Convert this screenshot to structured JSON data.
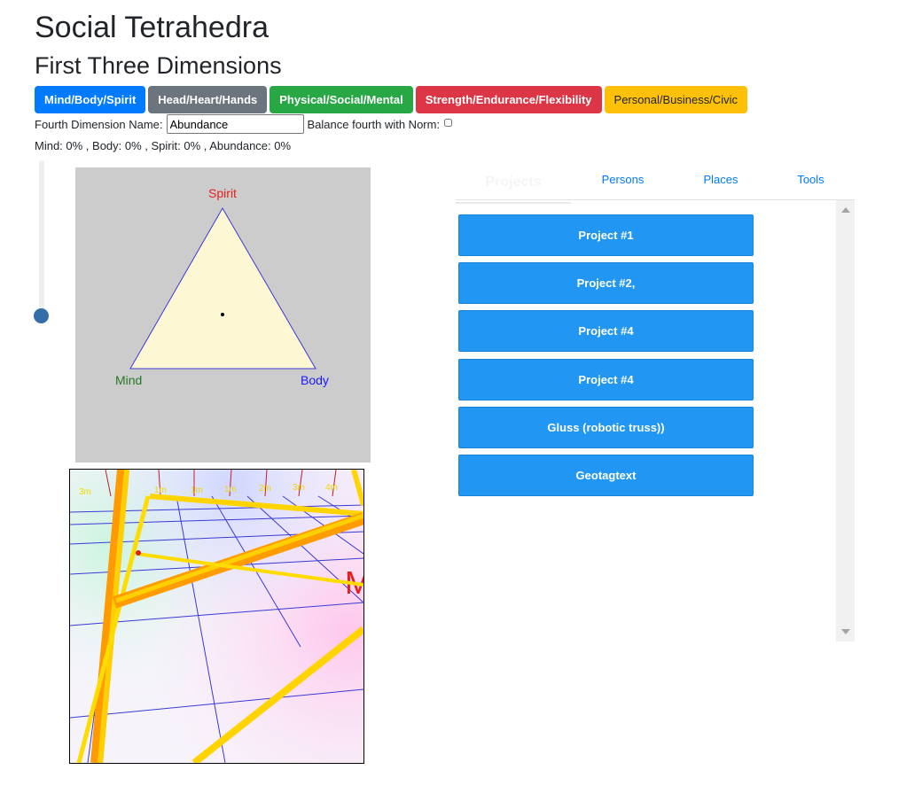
{
  "header": {
    "title": "Social Tetrahedra",
    "subtitle": "First Three Dimensions"
  },
  "presets": [
    {
      "label": "Mind/Body/Spirit",
      "color": "#007bff"
    },
    {
      "label": "Head/Heart/Hands",
      "color": "#6c757d"
    },
    {
      "label": "Physical/Social/Mental",
      "color": "#28a745"
    },
    {
      "label": "Strength/Endurance/Flexibility",
      "color": "#dc3545"
    },
    {
      "label": "Personal/Business/Civic",
      "color": "#ffc107"
    }
  ],
  "fourth": {
    "label": "Fourth Dimension Name:",
    "value": "Abundance",
    "balance_label": "Balance fourth with Norm:",
    "balance_checked": false
  },
  "percentages": "Mind: 0% , Body: 0% , Spirit: 0% , Abundance: 0%",
  "slider": {
    "value": 0
  },
  "triangle": {
    "top_label": "Spirit",
    "left_label": "Mind",
    "right_label": "Body",
    "colors": {
      "top": "#e8201e",
      "left": "#237a23",
      "right": "#1a1aff",
      "fill": "#fdf8d3",
      "stroke": "#3a3ad6"
    }
  },
  "scene": {
    "grid_labels": [
      "3m",
      "1m",
      "1m",
      "1m",
      "2m",
      "3m",
      "4m"
    ],
    "axis_text": "Mi"
  },
  "tabs": [
    {
      "label": "Projects",
      "active": true
    },
    {
      "label": "Persons",
      "active": false
    },
    {
      "label": "Places",
      "active": false
    },
    {
      "label": "Tools",
      "active": false
    }
  ],
  "items": [
    "Project #1",
    "Project #2,",
    "Project #4",
    "Project #4",
    "Gluss (robotic truss))",
    "Geotagtext"
  ]
}
